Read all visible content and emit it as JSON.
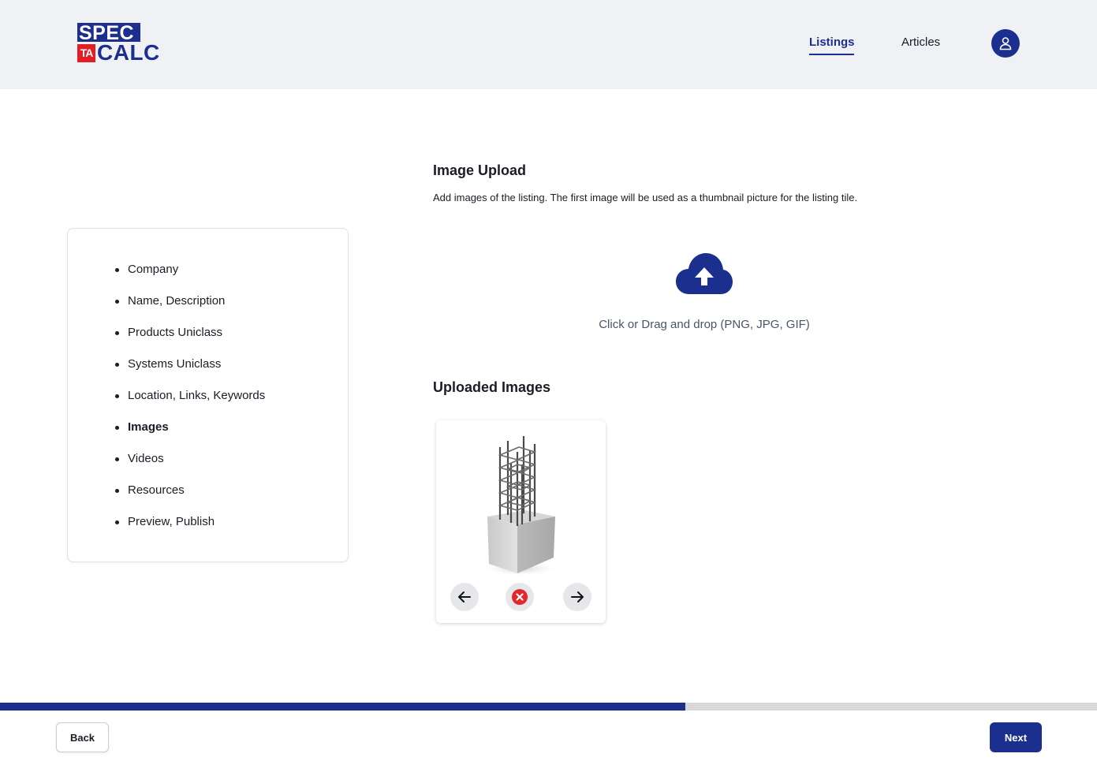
{
  "header": {
    "logo": {
      "line1": "SPEC",
      "badge": "TA",
      "line2": "CALC",
      "colors": {
        "blue": "#1b2f8f",
        "red": "#e31e24"
      }
    },
    "nav": [
      {
        "label": "Listings",
        "active": true
      },
      {
        "label": "Articles",
        "active": false
      }
    ],
    "avatar_icon": "user-icon"
  },
  "steps": [
    {
      "label": "Company",
      "current": false
    },
    {
      "label": "Name, Description",
      "current": false
    },
    {
      "label": "Products Uniclass",
      "current": false
    },
    {
      "label": "Systems Uniclass",
      "current": false
    },
    {
      "label": "Location, Links, Keywords",
      "current": false
    },
    {
      "label": "Images",
      "current": true
    },
    {
      "label": "Videos",
      "current": false
    },
    {
      "label": "Resources",
      "current": false
    },
    {
      "label": "Preview, Publish",
      "current": false
    }
  ],
  "upload": {
    "title": "Image Upload",
    "description": "Add images of the listing. The first image will be used as a thumbnail picture for the listing tile.",
    "dropzone_icon": "cloud-upload-icon",
    "dropzone_text": "Click or Drag and drop (PNG, JPG, GIF)"
  },
  "uploaded": {
    "title": "Uploaded Images",
    "images": [
      {
        "depicts": "rebar-cage-concrete-column",
        "actions": [
          "arrow-left-icon",
          "remove-icon",
          "arrow-right-icon"
        ]
      }
    ]
  },
  "progress": {
    "fraction": 0.625,
    "fill_color": "#1b2f8f",
    "track_color": "#d9d9d9"
  },
  "footer": {
    "back_label": "Back",
    "next_label": "Next"
  }
}
